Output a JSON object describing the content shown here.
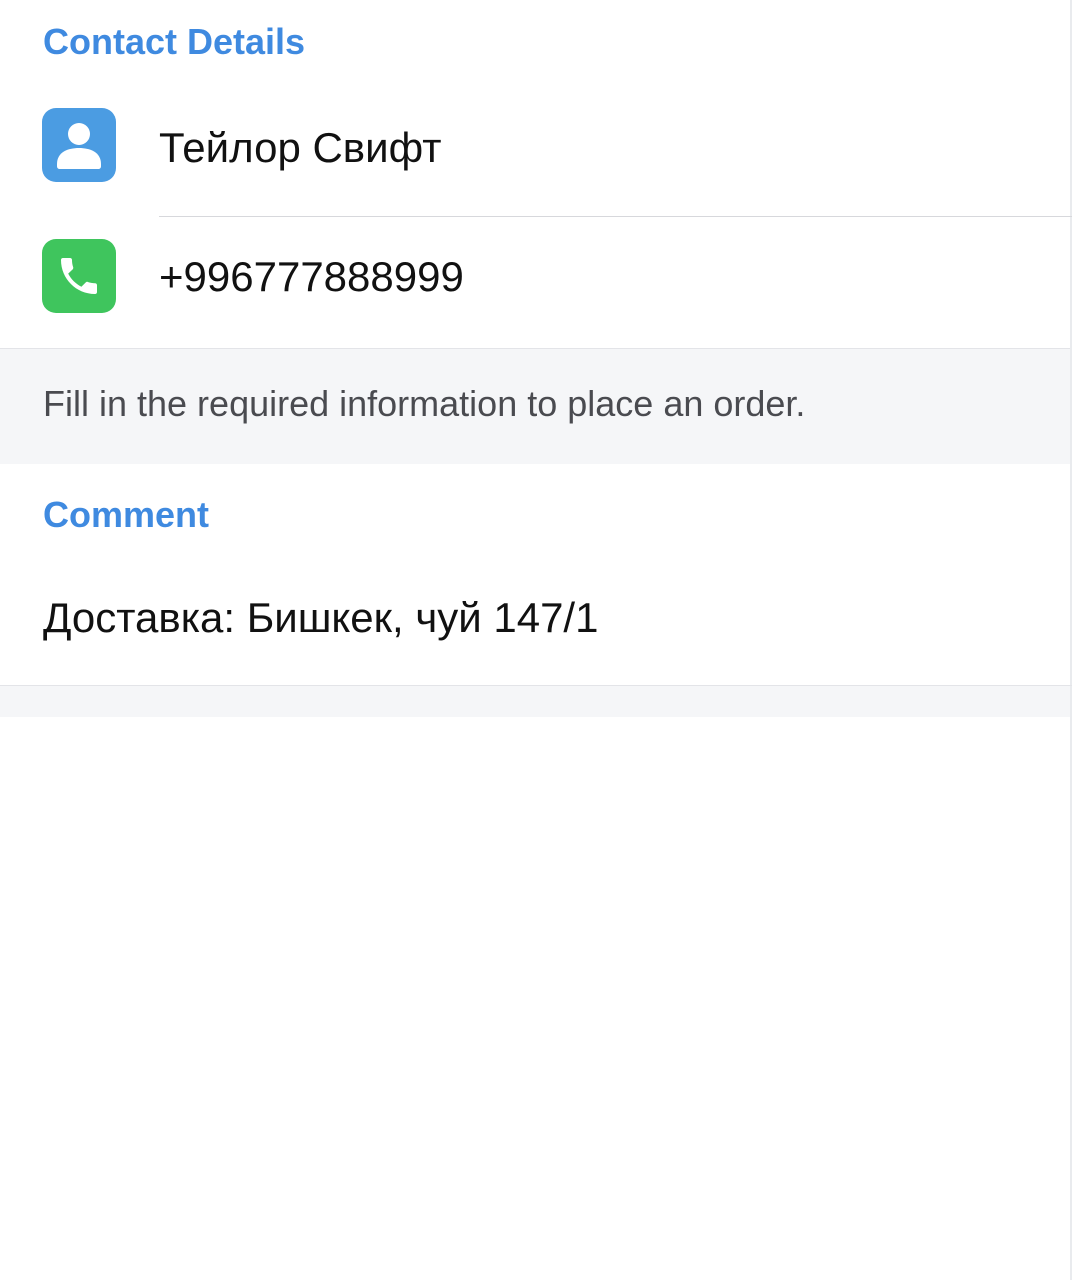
{
  "contact_details": {
    "header": "Contact Details",
    "name": {
      "icon": "person-icon",
      "value": "Тейлор Свифт"
    },
    "phone": {
      "icon": "phone-icon",
      "value": "+996777888999"
    }
  },
  "info": {
    "text": "Fill in the required information to place an order."
  },
  "comment": {
    "header": "Comment",
    "value": "Доставка: Бишкек, чуй 147/1"
  },
  "colors": {
    "accent": "#3f8ae0",
    "person_icon_bg": "#4b9ce2",
    "phone_icon_bg": "#3fc55d"
  }
}
